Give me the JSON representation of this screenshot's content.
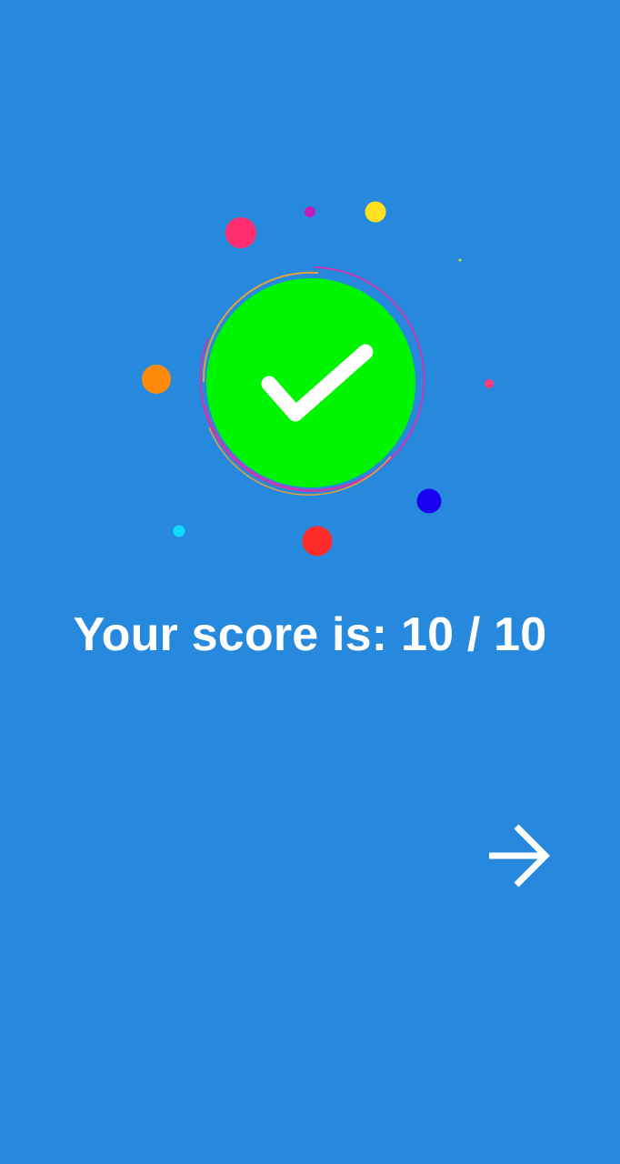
{
  "result": {
    "score_text": "Your score is: 10 / 10",
    "status": "correct"
  },
  "icons": {
    "badge": "check-circle-icon",
    "next": "arrow-right-icon"
  },
  "colors": {
    "background": "#2789de",
    "badge_fill": "#00f500",
    "check": "#ffffff",
    "text": "#ffffff",
    "confetti": [
      "#ff2d6f",
      "#c21cb8",
      "#ffe11f",
      "#ff8a0a",
      "#ff3b7a",
      "#1a00f0",
      "#ff2b2b",
      "#13d8ff",
      "#c8e83a"
    ]
  }
}
